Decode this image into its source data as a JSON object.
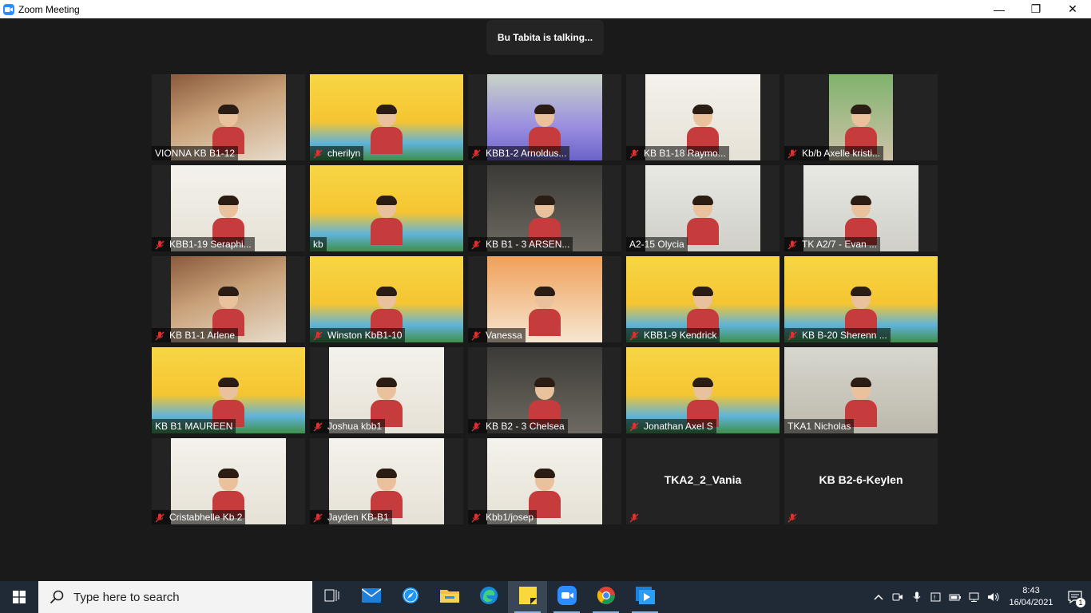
{
  "window": {
    "title": "Zoom Meeting",
    "controls": {
      "minimize": "—",
      "restore": "❐",
      "close": "✕"
    }
  },
  "meeting": {
    "talking_indicator": "Bu Tabita is talking...",
    "participants": [
      {
        "name": "VIONNA KB B1-12",
        "muted": false,
        "scene": "room"
      },
      {
        "name": "cherilyn",
        "muted": true,
        "scene": "park"
      },
      {
        "name": "KBB1-2 Arnoldus...",
        "muted": true,
        "scene": "purple"
      },
      {
        "name": "KB B1-18 Raymo...",
        "muted": true,
        "scene": "white"
      },
      {
        "name": "Kb/b Axelle kristi...",
        "muted": true,
        "scene": "green"
      },
      {
        "name": "KBB1-19 Seraphi...",
        "muted": true,
        "scene": "white"
      },
      {
        "name": "kb",
        "muted": false,
        "scene": "park"
      },
      {
        "name": "KB B1 - 3 ARSEN...",
        "muted": true,
        "scene": "dark"
      },
      {
        "name": "A2-15 Olycia",
        "muted": false,
        "scene": "grey"
      },
      {
        "name": "TK A2/7  -  Evan ...",
        "muted": true,
        "scene": "grey"
      },
      {
        "name": "KB B1-1 Arlene",
        "muted": true,
        "scene": "room"
      },
      {
        "name": "Winston KbB1-10",
        "muted": true,
        "scene": "park"
      },
      {
        "name": "Vanessa",
        "muted": true,
        "scene": "orange"
      },
      {
        "name": "KBB1-9 Kendrick",
        "muted": true,
        "scene": "park"
      },
      {
        "name": "KB B-20 Sherenn ...",
        "muted": true,
        "scene": "park"
      },
      {
        "name": "KB B1 MAUREEN",
        "muted": false,
        "scene": "park"
      },
      {
        "name": "Joshua kbb1",
        "muted": true,
        "scene": "white"
      },
      {
        "name": "KB B2 - 3 Chelsea",
        "muted": true,
        "scene": "dark"
      },
      {
        "name": "Jonathan Axel S",
        "muted": true,
        "scene": "park"
      },
      {
        "name": "TKA1 Nicholas",
        "muted": false,
        "scene": "flat"
      },
      {
        "name": "Cristabhelle Kb 2",
        "muted": true,
        "scene": "white"
      },
      {
        "name": "Jayden KB-B1",
        "muted": true,
        "scene": "white"
      },
      {
        "name": "Kbb1/josep",
        "muted": true,
        "scene": "white"
      },
      {
        "name": "TKA2_2_Vania",
        "muted": true,
        "scene": "none"
      },
      {
        "name": "KB B2-6-Keylen",
        "muted": true,
        "scene": "none"
      }
    ]
  },
  "taskbar": {
    "search_placeholder": "Type here to search",
    "apps": [
      {
        "icon": "task-view-icon",
        "running": false,
        "active": false
      },
      {
        "icon": "mail-icon",
        "running": false,
        "active": false
      },
      {
        "icon": "safari-compass-icon",
        "running": false,
        "active": false
      },
      {
        "icon": "file-explorer-icon",
        "running": false,
        "active": false
      },
      {
        "icon": "edge-icon",
        "running": false,
        "active": false
      },
      {
        "icon": "sticky-notes-icon",
        "running": true,
        "active": true
      },
      {
        "icon": "zoom-icon",
        "running": true,
        "active": false
      },
      {
        "icon": "chrome-icon",
        "running": true,
        "active": false
      },
      {
        "icon": "media-player-icon",
        "running": true,
        "active": false
      }
    ],
    "clock_time": "8:43",
    "clock_date": "16/04/2021",
    "notification_count": "1"
  },
  "colors": {
    "meeting_bg": "#1a1a1a",
    "tile_bg": "#232323",
    "taskbar_bg": "#1f2a36",
    "muted_red": "#e0302f",
    "zoom_blue": "#2d8cff"
  }
}
